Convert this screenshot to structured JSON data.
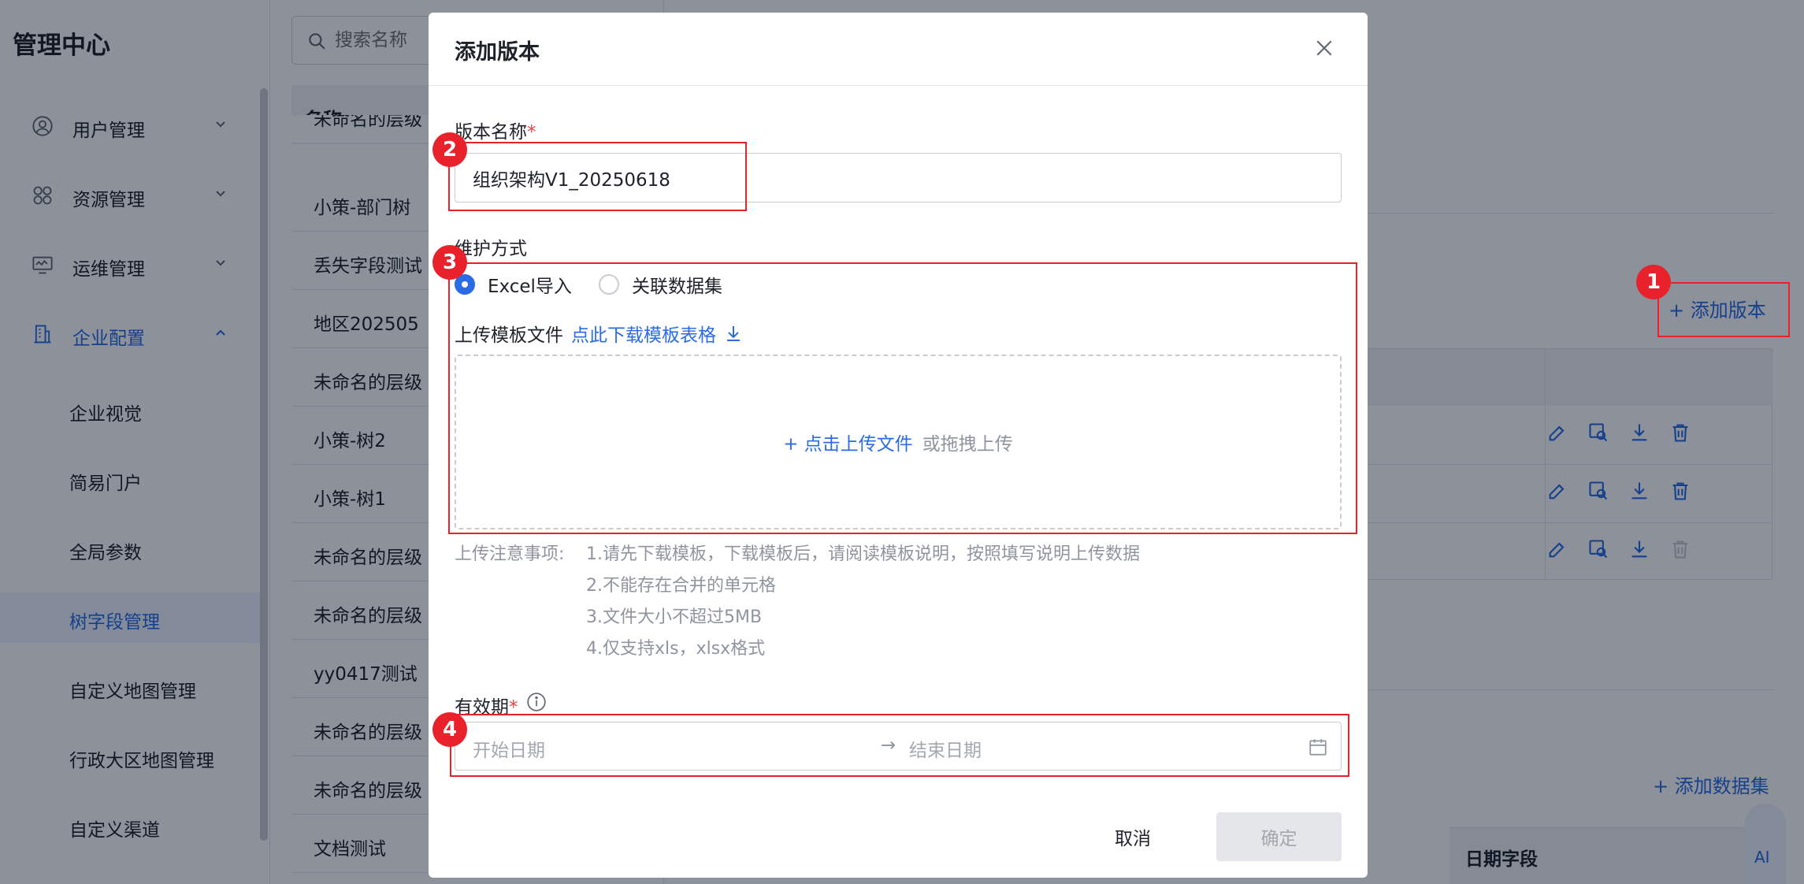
{
  "sidebar": {
    "title": "管理中心",
    "items": [
      {
        "label": "用户管理"
      },
      {
        "label": "资源管理"
      },
      {
        "label": "运维管理"
      },
      {
        "label": "企业配置"
      }
    ],
    "sub_items": [
      {
        "label": "企业视觉"
      },
      {
        "label": "简易门户"
      },
      {
        "label": "全局参数"
      },
      {
        "label": "树字段管理"
      },
      {
        "label": "自定义地图管理"
      },
      {
        "label": "行政大区地图管理"
      },
      {
        "label": "自定义渠道"
      }
    ]
  },
  "list": {
    "search_placeholder": "搜索名称",
    "header": "名称",
    "rows": [
      "未命名的层级",
      "小策-部门树",
      "丢失字段测试",
      "地区202505",
      "未命名的层级",
      "小策-树2",
      "小策-树1",
      "未命名的层级",
      "未命名的层级",
      "yy0417测试",
      "未命名的层级",
      "未命名的层级",
      "文档测试"
    ]
  },
  "main": {
    "add_version": "添加版本",
    "add_dataset": "添加数据集",
    "date_field_header": "日期字段",
    "ai_label": "AI"
  },
  "modal": {
    "title": "添加版本",
    "version_name_label": "版本名称",
    "version_name_value": "组织架构V1_20250618",
    "maintain_label": "维护方式",
    "radio_excel": "Excel导入",
    "radio_dataset": "关联数据集",
    "upload_label": "上传模板文件",
    "download_link": "点此下载模板表格",
    "upload_plus": "+",
    "upload_click": "点击上传文件",
    "upload_drag": "或拖拽上传",
    "notes_lead": "上传注意事项:",
    "notes": [
      "1.请先下载模板，下载模板后，请阅读模板说明，按照填写说明上传数据",
      "2.不能存在合并的单元格",
      "3.文件大小不超过5MB",
      "4.仅支持xls，xlsx格式"
    ],
    "validity_label": "有效期",
    "start_placeholder": "开始日期",
    "range_arrow": "→",
    "end_placeholder": "结束日期",
    "cancel": "取消",
    "confirm": "确定"
  },
  "required_mark": "*",
  "badges": [
    "1",
    "2",
    "3",
    "4"
  ],
  "colors": {
    "primary": "#2a6ce6",
    "annotation": "#e8212b",
    "required": "#e54545"
  }
}
